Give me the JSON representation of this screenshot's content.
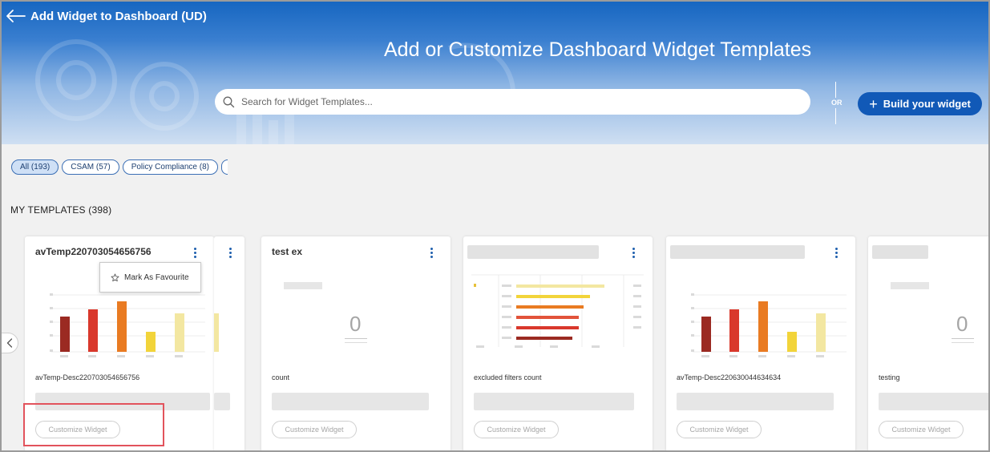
{
  "header": {
    "back_title": "Add Widget to Dashboard (UD)",
    "hero_title": "Add or Customize Dashboard Widget Templates",
    "search_placeholder": "Search for Widget Templates...",
    "or_label": "OR",
    "build_button": "Build your widget"
  },
  "filters": [
    {
      "label": "All (193)",
      "active": true
    },
    {
      "label": "CSAM (57)",
      "active": false
    },
    {
      "label": "Policy Compliance (8)",
      "active": false
    }
  ],
  "section_title": "MY TEMPLATES (398)",
  "popover": {
    "label": "Mark As Favourite",
    "icon": "star-icon"
  },
  "cards": [
    {
      "title": "avTemp220703054656756",
      "description": "avTemp-Desc220703054656756",
      "customize_label": "Customize Widget",
      "preview": "bar-chart"
    },
    {
      "title": "test ex",
      "description": "count",
      "count": "0",
      "customize_label": "Customize Widget",
      "preview": "count"
    },
    {
      "title": "",
      "description": "excluded filters count",
      "customize_label": "Customize Widget",
      "preview": "horizontal-bar"
    },
    {
      "title": "",
      "description": "avTemp-Desc220630044634634",
      "customize_label": "Customize Widget",
      "preview": "bar-chart"
    },
    {
      "title": "",
      "description": "testing",
      "count": "0",
      "customize_label": "Customize Widget",
      "preview": "count"
    }
  ],
  "colors": {
    "header_blue": "#1565c0",
    "button_blue": "#1159b7",
    "chip_border": "#3b6fb5",
    "highlight_red": "#e2535c",
    "bar_dark_red": "#9b2a22",
    "bar_red": "#d9382c",
    "bar_orange": "#e97b22",
    "bar_yellow": "#f2d43a",
    "bar_pale": "#f3e7a1"
  }
}
